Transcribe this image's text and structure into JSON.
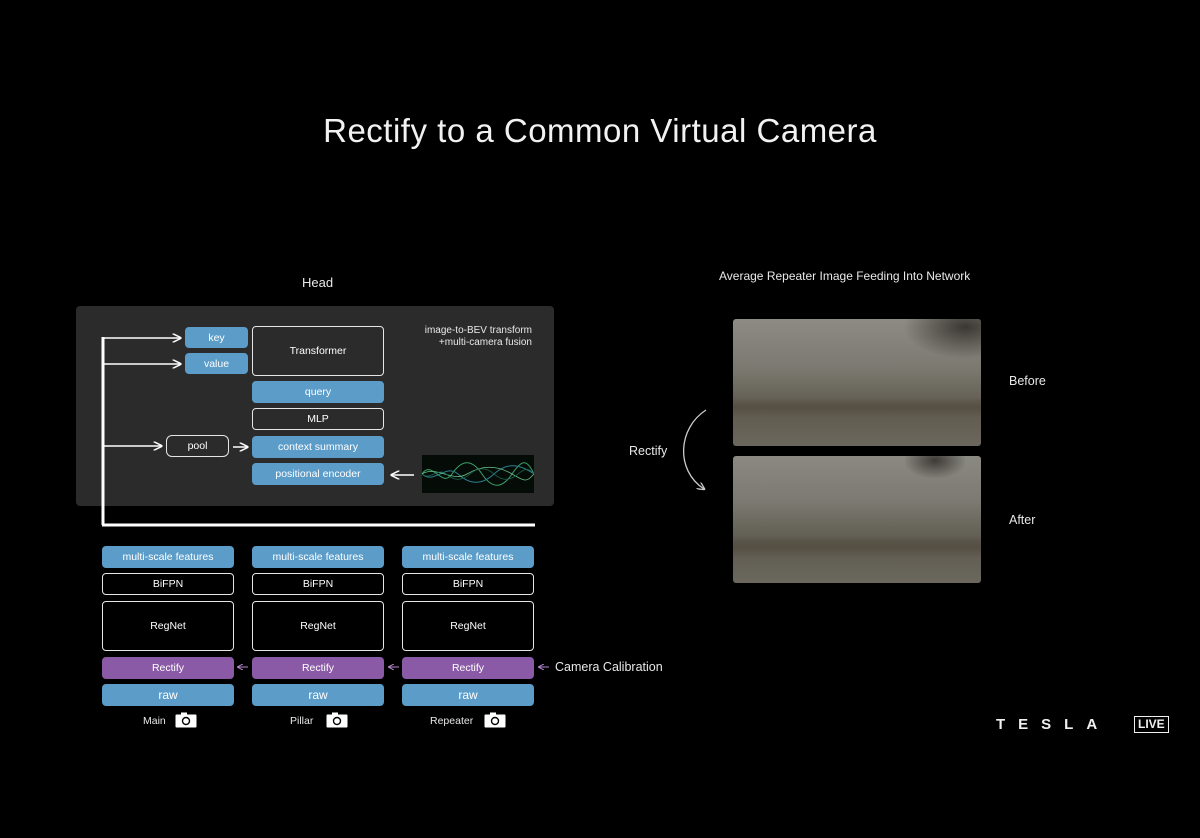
{
  "slide": {
    "title": "Rectify to a Common Virtual Camera"
  },
  "head": {
    "title": "Head",
    "fusion_label_line1": "image-to-BEV transform",
    "fusion_label_line2": "+multi-camera fusion",
    "key": "key",
    "value": "value",
    "transformer": "Transformer",
    "query": "query",
    "mlp": "MLP",
    "pool": "pool",
    "context_summary": "context summary",
    "positional_encoder": "positional encoder"
  },
  "columns": [
    {
      "camera": "Main",
      "features": "multi-scale features",
      "bifpn": "BiFPN",
      "backbone": "RegNet",
      "rectify": "Rectify",
      "raw": "raw"
    },
    {
      "camera": "Pillar",
      "features": "multi-scale features",
      "bifpn": "BiFPN",
      "backbone": "RegNet",
      "rectify": "Rectify",
      "raw": "raw"
    },
    {
      "camera": "Repeater",
      "features": "multi-scale features",
      "bifpn": "BiFPN",
      "backbone": "RegNet",
      "rectify": "Rectify",
      "raw": "raw"
    }
  ],
  "camera_calibration": "Camera Calibration",
  "right": {
    "title": "Average Repeater Image Feeding Into Network",
    "before": "Before",
    "after": "After",
    "rectify": "Rectify"
  },
  "branding": {
    "tesla": "TESLA",
    "live": "LIVE"
  },
  "colors": {
    "blue": "#5b9cc8",
    "purple": "#8a5aa6",
    "panel": "#2b2b2b"
  }
}
